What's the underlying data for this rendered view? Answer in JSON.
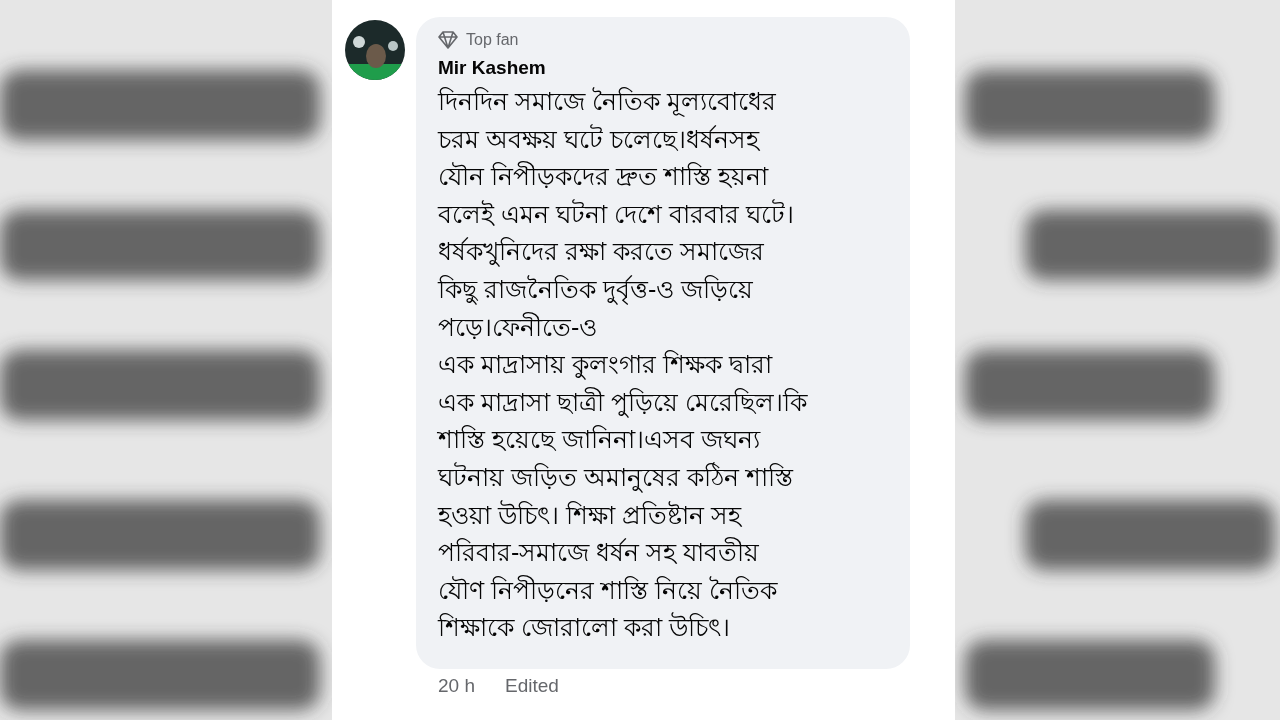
{
  "comment": {
    "badge": "Top fan",
    "author": "Mir Kashem",
    "lines": [
      "দিনদিন সমাজে নৈতিক মূল্যবোধের",
      "চরম অবক্ষয় ঘটে চলেছে।ধর্ষনসহ",
      "যৌন নিপীড়কদের দ্রুত শাস্তি হয়না",
      "বলেই এমন ঘটনা দেশে বারবার ঘটে।",
      "ধর্ষকখুনিদের রক্ষা করতে সমাজের",
      "কিছু রাজনৈতিক দুর্বৃত্ত-ও জড়িয়ে",
      "পড়ে।ফেনীতে-ও",
      "এক মাদ্রাসায় কুলংগার শিক্ষক দ্বারা",
      "এক মাদ্রাসা ছাত্রী পুড়িয়ে মেরেছিল।কি",
      "শাস্তি হয়েছে জানিনা।এসব জঘন্য",
      "ঘটনায় জড়িত অমানুষের কঠিন শাস্তি",
      "হওয়া উচিৎ। শিক্ষা প্রতিষ্টান সহ",
      "পরিবার-সমাজে ধর্ষন সহ যাবতীয়",
      "যৌণ নিপীড়নের শাস্তি নিয়ে নৈতিক",
      "শিক্ষাকে জোরালো করা উচিৎ।"
    ],
    "time": "20 h",
    "edited": "Edited"
  }
}
